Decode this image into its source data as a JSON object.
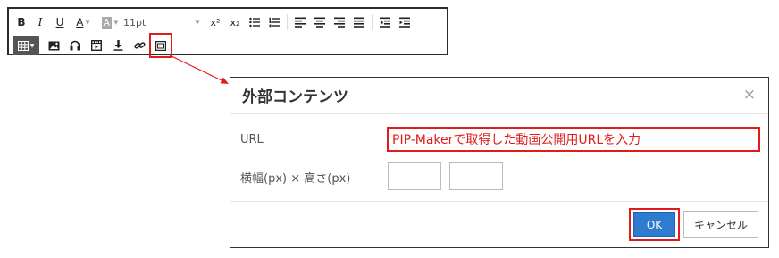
{
  "toolbar": {
    "bold": "B",
    "italic": "I",
    "underline": "U",
    "font_color": "A",
    "bg_color": "A",
    "font_size": "11pt",
    "superscript": "x²",
    "subscript": "x₂"
  },
  "dialog": {
    "title": "外部コンテンツ",
    "close": "×",
    "url_label": "URL",
    "url_value": "PIP-Makerで取得した動画公開用URLを入力",
    "size_label": "横幅(px) × 高さ(px)",
    "ok_label": "OK",
    "cancel_label": "キャンセル"
  },
  "colors": {
    "highlight": "#e01b1b",
    "ok_button": "#2f7bd0"
  }
}
